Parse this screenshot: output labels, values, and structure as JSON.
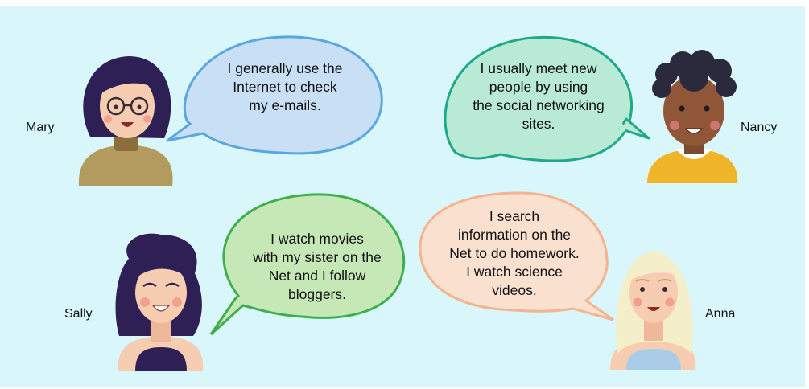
{
  "people": [
    {
      "name": "Mary",
      "lines": [
        "I generally use the",
        "Internet to check",
        "my e-mails."
      ],
      "bubble_fill": "#c9dff5",
      "bubble_stroke": "#5aa7e0"
    },
    {
      "name": "Nancy",
      "lines": [
        "I usually meet new",
        "people by using",
        "the social networking",
        "sites."
      ],
      "bubble_fill": "#b9ead6",
      "bubble_stroke": "#1fa987"
    },
    {
      "name": "Sally",
      "lines": [
        "I watch movies",
        "with my sister on the",
        "Net and I follow",
        "bloggers."
      ],
      "bubble_fill": "#c6e8b6",
      "bubble_stroke": "#3fae4d"
    },
    {
      "name": "Anna",
      "lines": [
        "I search",
        "information on the",
        "Net to do homework.",
        "I watch science",
        "videos."
      ],
      "bubble_fill": "#f9e0cf",
      "bubble_stroke": "#f3b48f"
    }
  ]
}
